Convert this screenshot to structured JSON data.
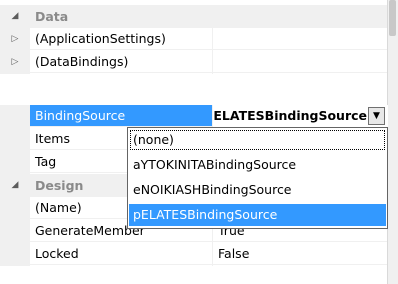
{
  "rows": [
    {
      "kind": "category",
      "expander": "◢",
      "label": "Data"
    },
    {
      "kind": "prop",
      "expander": "▷",
      "name": "(ApplicationSettings)",
      "value": ""
    },
    {
      "kind": "prop",
      "expander": "▷",
      "name": "(DataBindings)",
      "value": ""
    },
    {
      "kind": "prop",
      "expander": "",
      "name": "BindingSource",
      "value": "",
      "selected": true
    },
    {
      "kind": "prop",
      "expander": "",
      "name": "Items",
      "value": ""
    },
    {
      "kind": "prop",
      "expander": "",
      "name": "Tag",
      "value": ""
    },
    {
      "kind": "category",
      "expander": "◢",
      "label": "Design"
    },
    {
      "kind": "prop",
      "expander": "",
      "name": "(Name)",
      "value": ""
    },
    {
      "kind": "prop",
      "expander": "",
      "name": "GenerateMember",
      "value": "True"
    },
    {
      "kind": "prop",
      "expander": "",
      "name": "Locked",
      "value": "False"
    }
  ],
  "editor": {
    "text": "pELATESBindingSource",
    "dropdown_arrow": "▼"
  },
  "dropdown": {
    "items": [
      "(none)",
      "aYTOKINITABindingSource",
      "eNOIKIASHBindingSource",
      "pELATESBindingSource"
    ],
    "selected_index": 3
  },
  "colors": {
    "selection": "#3399ff",
    "category_bg": "#f0f0f0"
  }
}
